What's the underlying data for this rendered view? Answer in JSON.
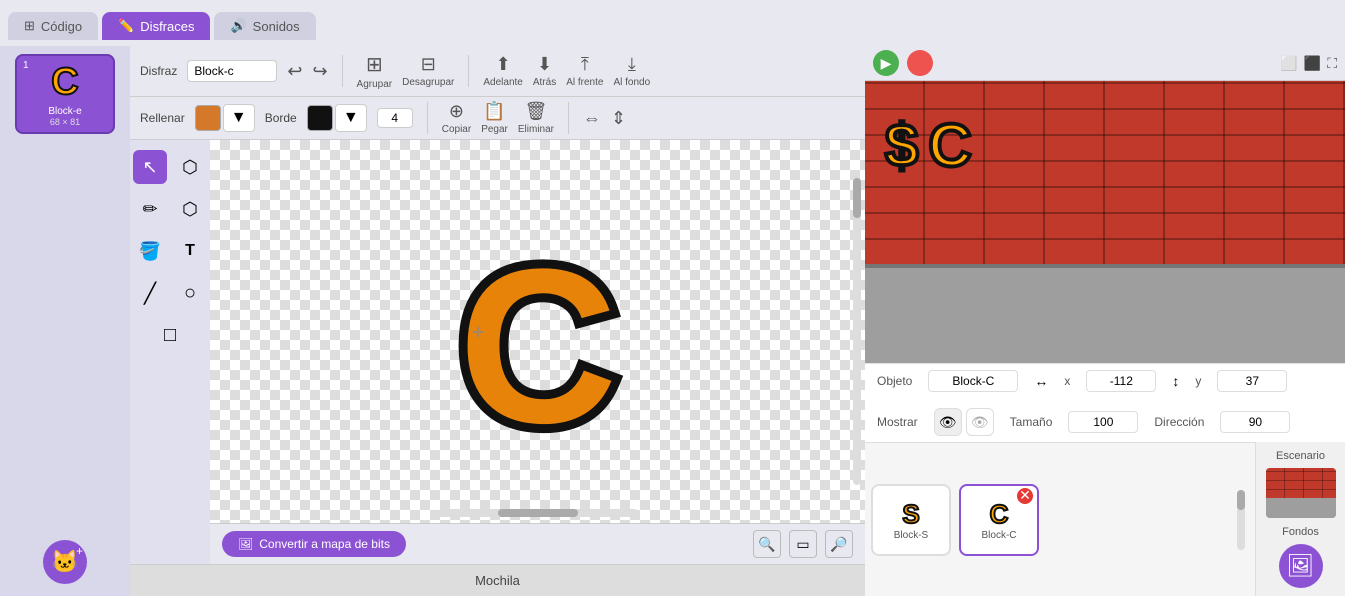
{
  "tabs": [
    {
      "id": "codigo",
      "label": "Código",
      "icon": "⊞",
      "active": false
    },
    {
      "id": "disfraces",
      "label": "Disfraces",
      "icon": "✏️",
      "active": true
    },
    {
      "id": "sonidos",
      "label": "Sonidos",
      "icon": "🔊",
      "active": false
    }
  ],
  "costume": {
    "label": "Disfraz",
    "name": "Block-c",
    "fill_label": "Rellenar",
    "border_label": "Borde",
    "border_size": "4",
    "fill_color": "#d4782a",
    "border_color": "#111111"
  },
  "toolbar_buttons": [
    {
      "id": "undo",
      "icon": "↩",
      "label": ""
    },
    {
      "id": "redo",
      "icon": "↪",
      "label": ""
    },
    {
      "id": "group",
      "icon": "⊞",
      "label": "Agrupar"
    },
    {
      "id": "ungroup",
      "icon": "⊟",
      "label": "Desagrupar"
    },
    {
      "id": "forward",
      "icon": "⬆",
      "label": "Adelante"
    },
    {
      "id": "back",
      "icon": "⬇",
      "label": "Atrás"
    },
    {
      "id": "front",
      "icon": "⤒",
      "label": "Al frente"
    },
    {
      "id": "back_most",
      "icon": "⤓",
      "label": "Al fondo"
    }
  ],
  "toolbar_buttons2": [
    {
      "id": "copy",
      "icon": "⊕",
      "label": "Copiar"
    },
    {
      "id": "paste",
      "icon": "📋",
      "label": "Pegar"
    },
    {
      "id": "delete",
      "icon": "🗑",
      "label": "Eliminar"
    },
    {
      "id": "flip_h",
      "icon": "⇔",
      "label": ""
    },
    {
      "id": "flip_v",
      "icon": "⇕",
      "label": ""
    }
  ],
  "tools": [
    {
      "id": "select",
      "icon": "↖",
      "active": true
    },
    {
      "id": "reshape",
      "icon": "⬡"
    },
    {
      "id": "pencil",
      "icon": "✏"
    },
    {
      "id": "fill",
      "icon": "🪣"
    },
    {
      "id": "bucket",
      "icon": "⬡"
    },
    {
      "id": "text",
      "icon": "T"
    },
    {
      "id": "line",
      "icon": "╱"
    },
    {
      "id": "circle",
      "icon": "○"
    },
    {
      "id": "rect",
      "icon": "□"
    }
  ],
  "canvas": {
    "letter": "C",
    "convert_label": "Convertir a mapa de bits"
  },
  "stage": {
    "title": "Escenario",
    "fondos_label": "Fondos",
    "letters": [
      "$",
      "C"
    ]
  },
  "properties": {
    "objeto_label": "Objeto",
    "objeto_value": "Block-C",
    "x_label": "x",
    "x_value": "-112",
    "y_label": "y",
    "y_value": "37",
    "mostrar_label": "Mostrar",
    "tamano_label": "Tamaño",
    "tamano_value": "100",
    "direccion_label": "Dirección",
    "direccion_value": "90"
  },
  "sprite_list": [
    {
      "id": "block-s",
      "letter": "S",
      "name": "Block-S",
      "active": false
    },
    {
      "id": "block-c",
      "letter": "C",
      "name": "Block-C",
      "active": true,
      "has_del": true
    }
  ],
  "left_sprite": {
    "number": "1",
    "letter": "C",
    "name": "Block-e",
    "size": "68 × 81"
  },
  "mochila": {
    "label": "Mochila"
  },
  "add_sprite_label": "+"
}
